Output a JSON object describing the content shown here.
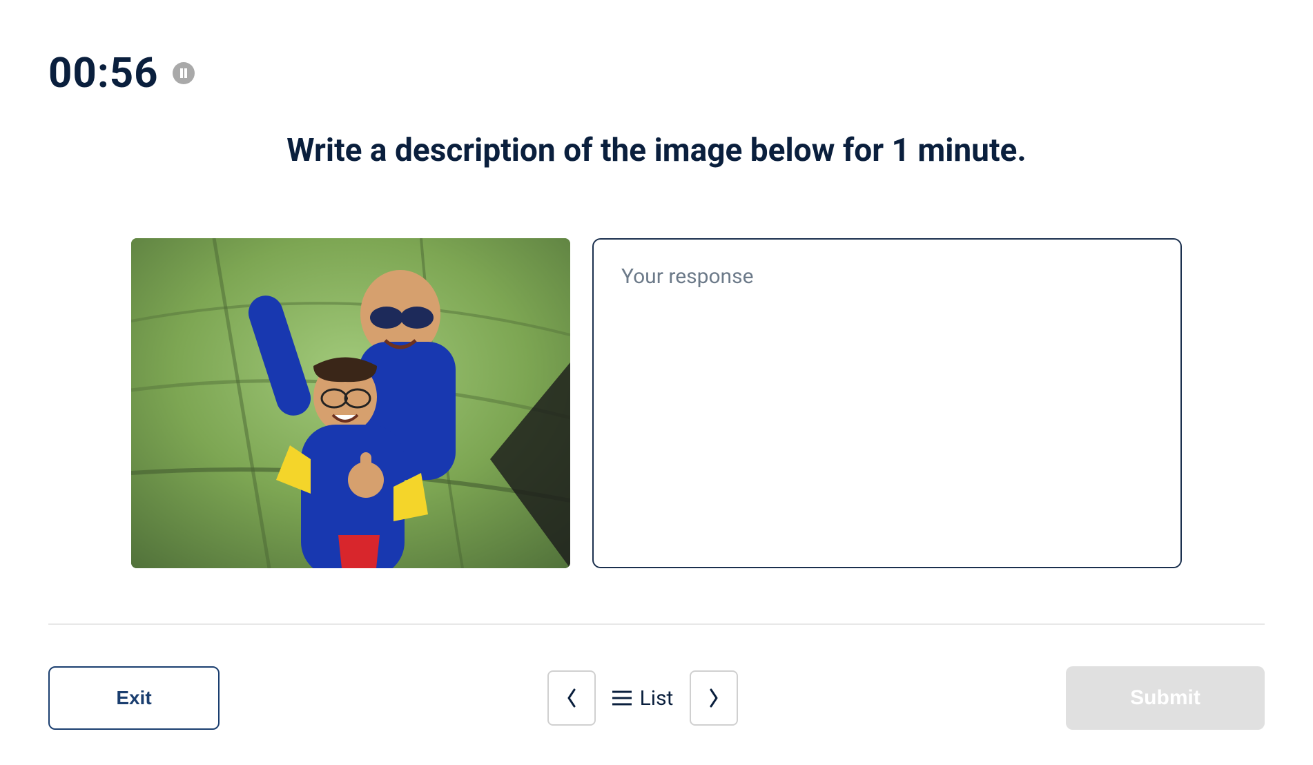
{
  "timer": {
    "value": "00:56"
  },
  "prompt": {
    "text": "Write a description of the image below for 1 minute."
  },
  "response": {
    "placeholder": "Your response",
    "value": ""
  },
  "footer": {
    "exit_label": "Exit",
    "list_label": "List",
    "submit_label": "Submit"
  }
}
